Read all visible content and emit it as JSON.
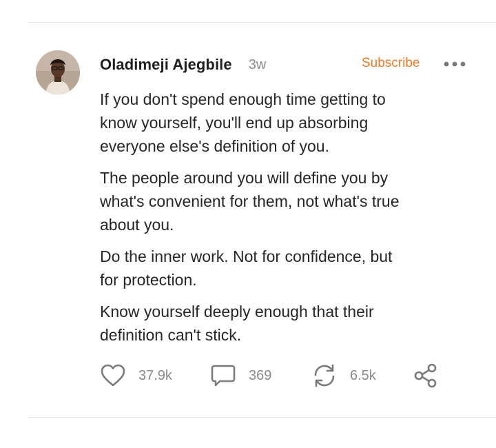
{
  "post": {
    "author": {
      "name": "Oladimeji Ajegbile",
      "avatar_icon": "person-avatar"
    },
    "timestamp": "3w",
    "subscribe_label": "Subscribe",
    "more_icon": "more-horizontal-icon",
    "paragraphs": [
      "If you don't spend enough time getting to\nknow yourself, you'll end up absorbing\neveryone else's definition of you.",
      "The people around you will define you by\nwhat's convenient for them, not what's true\nabout you.",
      "Do the inner work. Not for confidence, but\nfor protection.",
      "Know yourself deeply enough that their\ndefinition can't stick."
    ],
    "actions": {
      "likes": "37.9k",
      "comments": "369",
      "restacks": "6.5k",
      "icons": {
        "like": "heart-icon",
        "comment": "comment-icon",
        "restack": "restack-icon",
        "share": "share-icon"
      }
    }
  },
  "colors": {
    "accent": "#f2781e",
    "muted": "#8a8a8a",
    "text": "#262626"
  }
}
